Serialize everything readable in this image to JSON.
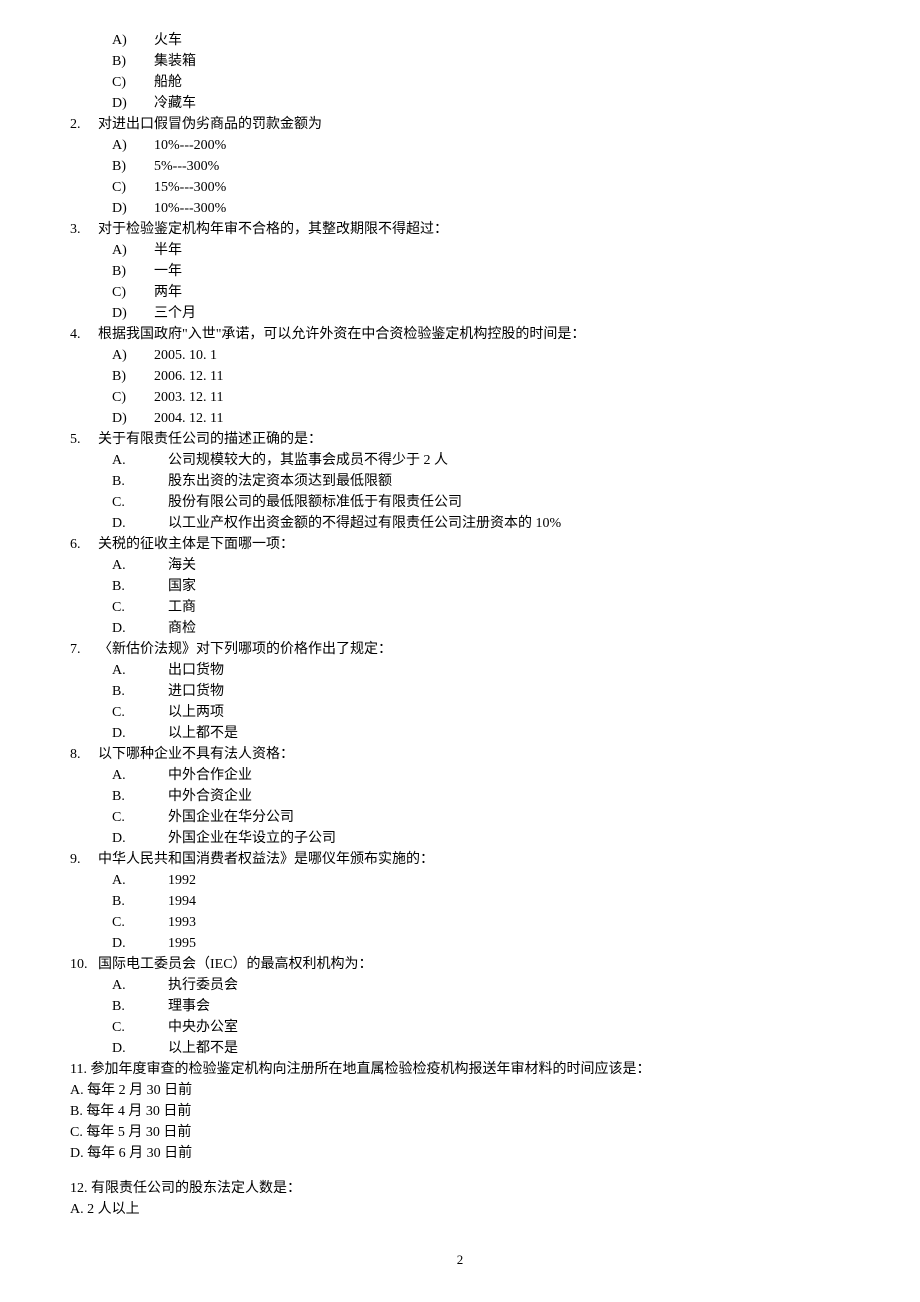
{
  "q1_continued": {
    "opts": [
      {
        "l": "A)",
        "t": "火车"
      },
      {
        "l": "B)",
        "t": "集装箱"
      },
      {
        "l": "C)",
        "t": "船舱"
      },
      {
        "l": "D)",
        "t": "冷藏车"
      }
    ]
  },
  "q2": {
    "num": "2.",
    "stem": "对进出口假冒伪劣商品的罚款金额为",
    "opts": [
      {
        "l": "A)",
        "t": "10%---200%"
      },
      {
        "l": "B)",
        "t": "5%---300%"
      },
      {
        "l": "C)",
        "t": "15%---300%"
      },
      {
        "l": "D)",
        "t": "10%---300%"
      }
    ]
  },
  "q3": {
    "num": "3.",
    "stem": "对于检验鉴定机构年审不合格的，其整改期限不得超过：",
    "opts": [
      {
        "l": "A)",
        "t": "半年"
      },
      {
        "l": "B)",
        "t": "一年"
      },
      {
        "l": "C)",
        "t": "两年"
      },
      {
        "l": "D)",
        "t": "三个月"
      }
    ]
  },
  "q4": {
    "num": "4.",
    "stem": "根据我国政府\"入世\"承诺，可以允许外资在中合资检验鉴定机构控股的时间是：",
    "opts": [
      {
        "l": "A)",
        "t": "2005. 10. 1"
      },
      {
        "l": "B)",
        "t": "2006. 12. 11"
      },
      {
        "l": "C)",
        "t": "2003. 12. 11"
      },
      {
        "l": "D)",
        "t": "2004. 12. 11"
      }
    ]
  },
  "q5": {
    "num": "5.",
    "stem": "关于有限责任公司的描述正确的是：",
    "opts": [
      {
        "l": "A.",
        "t": "公司规模较大的，其监事会成员不得少于 2 人"
      },
      {
        "l": "B.",
        "t": "股东出资的法定资本须达到最低限额"
      },
      {
        "l": "C.",
        "t": "股份有限公司的最低限额标准低于有限责任公司"
      },
      {
        "l": "D.",
        "t": "以工业产权作出资金额的不得超过有限责任公司注册资本的 10%"
      }
    ]
  },
  "q6": {
    "num": "6.",
    "stem": "关税的征收主体是下面哪一项：",
    "opts": [
      {
        "l": "A.",
        "t": "海关"
      },
      {
        "l": "B.",
        "t": "国家"
      },
      {
        "l": "C.",
        "t": "工商"
      },
      {
        "l": "D.",
        "t": "商检"
      }
    ]
  },
  "q7": {
    "num": "7.",
    "stem": "〈新估价法规》对下列哪项的价格作出了规定：",
    "opts": [
      {
        "l": "A.",
        "t": "出口货物"
      },
      {
        "l": "B.",
        "t": "进口货物"
      },
      {
        "l": "C.",
        "t": "以上两项"
      },
      {
        "l": "D.",
        "t": "以上都不是"
      }
    ]
  },
  "q8": {
    "num": "8.",
    "stem": "以下哪种企业不具有法人资格：",
    "opts": [
      {
        "l": "A.",
        "t": "中外合作企业"
      },
      {
        "l": "B.",
        "t": "中外合资企业"
      },
      {
        "l": "C.",
        "t": "外国企业在华分公司"
      },
      {
        "l": "D.",
        "t": "外国企业在华设立的子公司"
      }
    ]
  },
  "q9": {
    "num": "9.",
    "stem": "中华人民共和国消费者权益法》是哪仪年颁布实施的：",
    "opts": [
      {
        "l": "A.",
        "t": "1992"
      },
      {
        "l": "B.",
        "t": "1994"
      },
      {
        "l": "C.",
        "t": "1993"
      },
      {
        "l": "D.",
        "t": "1995"
      }
    ]
  },
  "q10": {
    "num": "10.",
    "stem": "国际电工委员会（IEC）的最高权利机构为：",
    "opts": [
      {
        "l": "A.",
        "t": "执行委员会"
      },
      {
        "l": "B.",
        "t": "理事会"
      },
      {
        "l": "C.",
        "t": "中央办公室"
      },
      {
        "l": "D.",
        "t": "以上都不是"
      }
    ]
  },
  "q11": {
    "stem": "11. 参加年度审查的检验鉴定机构向注册所在地直属检验检疫机构报送年审材料的时间应该是：",
    "opts": [
      "A. 每年 2 月 30 日前",
      "B. 每年 4 月 30 日前",
      "C. 每年 5 月 30 日前",
      "D. 每年 6 月 30 日前"
    ]
  },
  "q12": {
    "stem": "12. 有限责任公司的股东法定人数是：",
    "opts": [
      "A. 2 人以上"
    ]
  },
  "page_number": "2"
}
